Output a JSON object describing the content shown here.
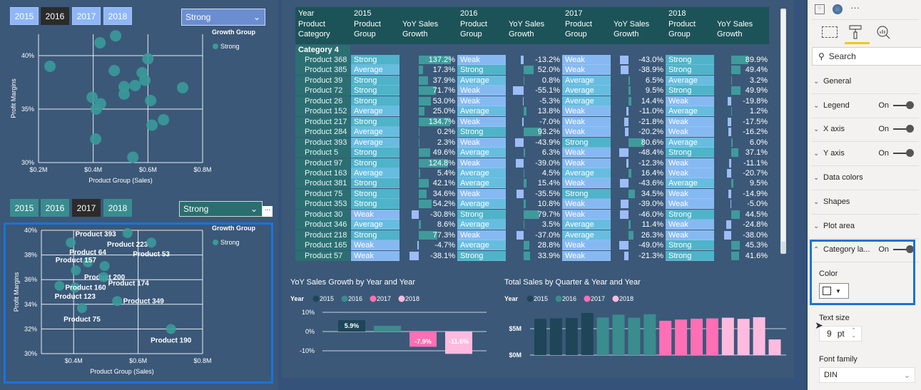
{
  "colors": {
    "accent": "#1a73d9",
    "strong": "#4fb3c9",
    "average": "#66bde0",
    "weak": "#86b9f2",
    "pos_bar": "#3f9a9c",
    "neg_bar": "#9dbcf8",
    "y2015": "#1f4558",
    "y2016": "#3a8c8f",
    "y2017": "#ff6fb5",
    "y2018": "#ffbbdf"
  },
  "top_slicer": {
    "years": [
      "2015",
      "2016",
      "2017",
      "2018"
    ],
    "selected": "2016",
    "dropdown": "Strong"
  },
  "bottom_slicer": {
    "years": [
      "2015",
      "2016",
      "2017",
      "2018"
    ],
    "selected": "2017",
    "dropdown": "Strong",
    "more": "..."
  },
  "chart_data": [
    {
      "type": "scatter",
      "xlabel": "Product Group (Sales)",
      "ylabel": "Profit Margins",
      "xlim": [
        0.2,
        0.8
      ],
      "ylim": [
        30,
        42
      ],
      "xticks": [
        "$0.2M",
        "$0.4M",
        "$0.6M",
        "$0.8M"
      ],
      "yticks": [
        "30%",
        "35%",
        "40%"
      ],
      "legend_title": "Growth Group",
      "legend": [
        "Strong"
      ],
      "legend_position": "right",
      "grid": true,
      "points": [
        [
          0.482,
          41.85
        ],
        [
          0.425,
          41.2
        ],
        [
          0.242,
          39.0
        ],
        [
          0.477,
          38.6
        ],
        [
          0.6,
          39.7
        ],
        [
          0.579,
          38.4
        ],
        [
          0.589,
          37.7
        ],
        [
          0.513,
          37.1
        ],
        [
          0.553,
          37.2
        ],
        [
          0.727,
          37.0
        ],
        [
          0.513,
          36.4
        ],
        [
          0.396,
          36.1
        ],
        [
          0.427,
          35.5
        ],
        [
          0.411,
          35.0
        ],
        [
          0.61,
          35.8
        ],
        [
          0.657,
          34.0
        ],
        [
          0.615,
          33.5
        ],
        [
          0.409,
          32.2
        ],
        [
          0.545,
          30.5
        ]
      ]
    },
    {
      "type": "scatter",
      "xlabel": "Product Group (Sales)",
      "ylabel": "Profit Margins",
      "xlim": [
        0.3,
        0.8
      ],
      "ylim": [
        30,
        40
      ],
      "xticks": [
        "$0.4M",
        "$0.6M",
        "$0.8M"
      ],
      "yticks": [
        "30%",
        "32%",
        "34%",
        "36%",
        "38%",
        "40%"
      ],
      "legend_title": "Growth Group",
      "legend": [
        "Strong"
      ],
      "legend_position": "right",
      "grid": true,
      "points": [
        {
          "name": "Product 223",
          "x": 0.567,
          "y": 39.77
        },
        {
          "name": "Product 393",
          "x": 0.391,
          "y": 39.0
        },
        {
          "name": "Product 53",
          "x": 0.641,
          "y": 39.0
        },
        {
          "name": "Product 64",
          "x": 0.444,
          "y": 37.4
        },
        {
          "name": "Product 200",
          "x": 0.496,
          "y": 37.1
        },
        {
          "name": "Product 157",
          "x": 0.407,
          "y": 36.75
        },
        {
          "name": "Product 174",
          "x": 0.493,
          "y": 36.2
        },
        {
          "name": "Product 123",
          "x": 0.356,
          "y": 35.5
        },
        {
          "name": "Product 160",
          "x": 0.404,
          "y": 35.36
        },
        {
          "name": "Product 349",
          "x": 0.535,
          "y": 34.26
        },
        {
          "name": "Product 75",
          "x": 0.426,
          "y": 33.7
        },
        {
          "name": "Product 190",
          "x": 0.702,
          "y": 32.0
        }
      ]
    },
    {
      "type": "bar",
      "title": "YoY Sales Growth by Year and Year",
      "legend_title": "Year",
      "legend": [
        "2015",
        "2016",
        "2017",
        "2018"
      ],
      "legend_position": "top-left",
      "categories": [
        "2015",
        "2016",
        "2017",
        "2018"
      ],
      "values": [
        5.9,
        3.0,
        -7.9,
        -11.6
      ],
      "labels": [
        "5.9%",
        "",
        "-7.9%",
        "-11.6%"
      ],
      "ylim": [
        -10,
        10
      ],
      "yticks": [
        "10%",
        "0%",
        "-10%"
      ]
    },
    {
      "type": "bar",
      "title": "Total Sales by Quarter & Year and Year",
      "legend_title": "Year",
      "legend": [
        "2015",
        "2016",
        "2017",
        "2018"
      ],
      "legend_position": "top-left",
      "series": [
        {
          "name": "2015",
          "values": [
            6.86,
            6.95,
            7.04,
            7.96
          ]
        },
        {
          "name": "2016",
          "values": [
            7.12,
            7.65,
            7.08,
            7.74
          ]
        },
        {
          "name": "2017",
          "values": [
            6.5,
            6.73,
            6.9,
            6.95
          ]
        },
        {
          "name": "2018",
          "values": [
            7.08,
            6.86,
            7.17,
            2.96
          ]
        }
      ],
      "yticks": [
        "$0M",
        "$5M"
      ],
      "ylim": [
        0,
        8
      ]
    }
  ],
  "table": {
    "year_label": "Year",
    "category_label1": "Product",
    "category_label2": "Category",
    "years": [
      "2015",
      "2016",
      "2017",
      "2018"
    ],
    "group1": "Product",
    "group2": "Group",
    "growth1": "YoY Sales",
    "growth2": "Growth",
    "category": "Category 4",
    "rows": [
      [
        "Product 368",
        "Strong",
        "137.2%",
        "Weak",
        "-13.2%",
        "Weak",
        "-43.0%",
        "Strong",
        "89.9%"
      ],
      [
        "Product 385",
        "Average",
        "17.3%",
        "Strong",
        "52.0%",
        "Weak",
        "-38.9%",
        "Strong",
        "49.4%"
      ],
      [
        "Product 39",
        "Strong",
        "37.9%",
        "Average",
        "0.8%",
        "Average",
        "6.5%",
        "Average",
        "3.2%"
      ],
      [
        "Product 72",
        "Strong",
        "71.7%",
        "Weak",
        "-55.1%",
        "Average",
        "9.5%",
        "Strong",
        "49.9%"
      ],
      [
        "Product 26",
        "Strong",
        "53.0%",
        "Weak",
        "-5.3%",
        "Average",
        "14.4%",
        "Weak",
        "-19.8%"
      ],
      [
        "Product 152",
        "Average",
        "25.0%",
        "Average",
        "13.8%",
        "Weak",
        "-11.0%",
        "Average",
        "1.2%"
      ],
      [
        "Product 217",
        "Strong",
        "134.7%",
        "Weak",
        "-7.0%",
        "Weak",
        "-21.8%",
        "Weak",
        "-17.5%"
      ],
      [
        "Product 284",
        "Average",
        "0.2%",
        "Strong",
        "93.2%",
        "Weak",
        "-20.2%",
        "Weak",
        "-16.2%"
      ],
      [
        "Product 393",
        "Average",
        "2.3%",
        "Weak",
        "-43.9%",
        "Strong",
        "80.6%",
        "Average",
        "6.0%"
      ],
      [
        "Product 5",
        "Strong",
        "49.6%",
        "Average",
        "6.3%",
        "Weak",
        "-48.4%",
        "Strong",
        "37.1%"
      ],
      [
        "Product 97",
        "Strong",
        "124.8%",
        "Weak",
        "-39.0%",
        "Weak",
        "-12.3%",
        "Weak",
        "-11.1%"
      ],
      [
        "Product 163",
        "Average",
        "5.4%",
        "Average",
        "4.5%",
        "Average",
        "16.4%",
        "Weak",
        "-20.7%"
      ],
      [
        "Product 381",
        "Strong",
        "42.1%",
        "Average",
        "15.4%",
        "Weak",
        "-43.6%",
        "Average",
        "9.5%"
      ],
      [
        "Product 75",
        "Strong",
        "34.6%",
        "Weak",
        "-35.5%",
        "Strong",
        "34.5%",
        "Weak",
        "-14.9%"
      ],
      [
        "Product 353",
        "Strong",
        "54.2%",
        "Average",
        "10.8%",
        "Weak",
        "-39.0%",
        "Weak",
        "-5.0%"
      ],
      [
        "Product 30",
        "Weak",
        "-30.8%",
        "Strong",
        "79.7%",
        "Weak",
        "-46.0%",
        "Strong",
        "44.5%"
      ],
      [
        "Product 346",
        "Average",
        "8.6%",
        "Average",
        "3.5%",
        "Average",
        "11.4%",
        "Weak",
        "-24.8%"
      ],
      [
        "Product 218",
        "Strong",
        "77.3%",
        "Weak",
        "-37.0%",
        "Average",
        "26.3%",
        "Weak",
        "-38.0%"
      ],
      [
        "Product 165",
        "Weak",
        "-4.7%",
        "Average",
        "28.8%",
        "Weak",
        "-49.0%",
        "Strong",
        "45.3%"
      ],
      [
        "Product 57",
        "Weak",
        "-38.1%",
        "Strong",
        "33.9%",
        "Weak",
        "-21.3%",
        "Strong",
        "41.6%"
      ]
    ]
  },
  "pane": {
    "more": "···",
    "search_placeholder": "Search",
    "sections": [
      {
        "label": "General"
      },
      {
        "label": "Legend",
        "toggle": "On"
      },
      {
        "label": "X axis",
        "toggle": "On"
      },
      {
        "label": "Y axis",
        "toggle": "On"
      },
      {
        "label": "Data colors"
      },
      {
        "label": "Shapes"
      },
      {
        "label": "Plot area"
      },
      {
        "label": "Category la...",
        "toggle": "On",
        "expanded": true
      }
    ],
    "color_label": "Color",
    "text_size_label": "Text size",
    "text_size_value": "9",
    "text_size_unit": "pt",
    "font_family_label": "Font family",
    "font_family_value": "DIN"
  }
}
